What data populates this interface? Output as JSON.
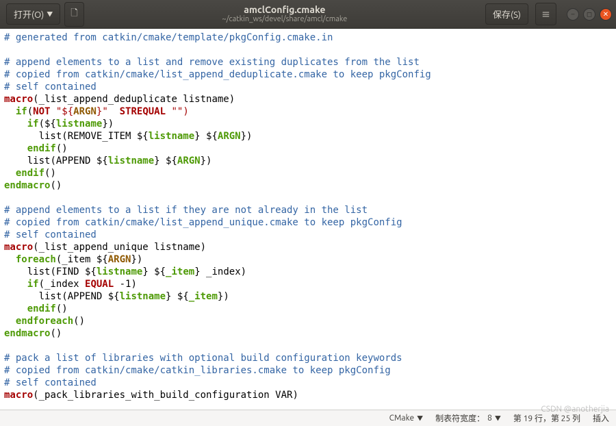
{
  "titlebar": {
    "open_label": "打开(O)",
    "save_label": "保存(S)",
    "title": "amclConfig.cmake",
    "subtitle": "~/catkin_ws/devel/share/amcl/cmake"
  },
  "code": {
    "lines": [
      {
        "t": "comment",
        "s": "# generated from catkin/cmake/template/pkgConfig.cmake.in"
      },
      {
        "t": "blank",
        "s": ""
      },
      {
        "t": "comment",
        "s": "# append elements to a list and remove existing duplicates from the list"
      },
      {
        "t": "comment",
        "s": "# copied from catkin/cmake/list_append_deduplicate.cmake to keep pkgConfig"
      },
      {
        "t": "comment",
        "s": "# self contained"
      },
      {
        "t": "macro1",
        "indent": "",
        "kw": "macro",
        "body": "(_list_append_deduplicate listname)"
      },
      {
        "t": "ifnot",
        "indent": "  ",
        "kw": "if",
        "pre": "(",
        "kw2": "NOT",
        "mid": " \"${",
        "arg": "ARGN",
        "mid2": "}\"  ",
        "kw3": "STREQUAL",
        "post": " \"\")"
      },
      {
        "t": "ifvar",
        "indent": "    ",
        "kw": "if",
        "pre": "(${",
        "var": "listname",
        "post": "})"
      },
      {
        "t": "list2",
        "indent": "      ",
        "fn": "list",
        "pre": "(REMOVE_ITEM ${",
        "v1": "listname",
        "mid": "} ${",
        "v2": "ARGN",
        "post": "})"
      },
      {
        "t": "end",
        "indent": "    ",
        "kw": "endif",
        "post": "()"
      },
      {
        "t": "list2",
        "indent": "    ",
        "fn": "list",
        "pre": "(APPEND ${",
        "v1": "listname",
        "mid": "} ${",
        "v2": "ARGN",
        "post": "})"
      },
      {
        "t": "end",
        "indent": "  ",
        "kw": "endif",
        "post": "()"
      },
      {
        "t": "end",
        "indent": "",
        "kw": "endmacro",
        "post": "()"
      },
      {
        "t": "blank",
        "s": ""
      },
      {
        "t": "comment",
        "s": "# append elements to a list if they are not already in the list"
      },
      {
        "t": "comment",
        "s": "# copied from catkin/cmake/list_append_unique.cmake to keep pkgConfig"
      },
      {
        "t": "comment",
        "s": "# self contained"
      },
      {
        "t": "macro1",
        "indent": "",
        "kw": "macro",
        "body": "(_list_append_unique listname)"
      },
      {
        "t": "foreach",
        "indent": "  ",
        "kw": "foreach",
        "pre": "(_item ${",
        "arg": "ARGN",
        "post": "})"
      },
      {
        "t": "list2",
        "indent": "    ",
        "fn": "list",
        "pre": "(FIND ${",
        "v1": "listname",
        "mid": "} ${",
        "v2": "_item",
        "post": "} _index)"
      },
      {
        "t": "ifeq",
        "indent": "    ",
        "kw": "if",
        "pre": "(_index ",
        "kw2": "EQUAL",
        "post": " -1)"
      },
      {
        "t": "list2",
        "indent": "      ",
        "fn": "list",
        "pre": "(APPEND ${",
        "v1": "listname",
        "mid": "} ${",
        "v2": "_item",
        "post": "})"
      },
      {
        "t": "end",
        "indent": "    ",
        "kw": "endif",
        "post": "()"
      },
      {
        "t": "end",
        "indent": "  ",
        "kw": "endforeach",
        "post": "()"
      },
      {
        "t": "end",
        "indent": "",
        "kw": "endmacro",
        "post": "()"
      },
      {
        "t": "blank",
        "s": ""
      },
      {
        "t": "comment",
        "s": "# pack a list of libraries with optional build configuration keywords"
      },
      {
        "t": "comment",
        "s": "# copied from catkin/cmake/catkin_libraries.cmake to keep pkgConfig"
      },
      {
        "t": "comment",
        "s": "# self contained"
      },
      {
        "t": "macro1",
        "indent": "",
        "kw": "macro",
        "body": "(_pack_libraries_with_build_configuration VAR)"
      }
    ]
  },
  "statusbar": {
    "language": "CMake",
    "tabwidth_label": "制表符宽度：",
    "tabwidth_value": "8",
    "position": "第 19 行，第 25 列",
    "mode": "插入"
  },
  "watermark": "CSDN @anotherjia"
}
